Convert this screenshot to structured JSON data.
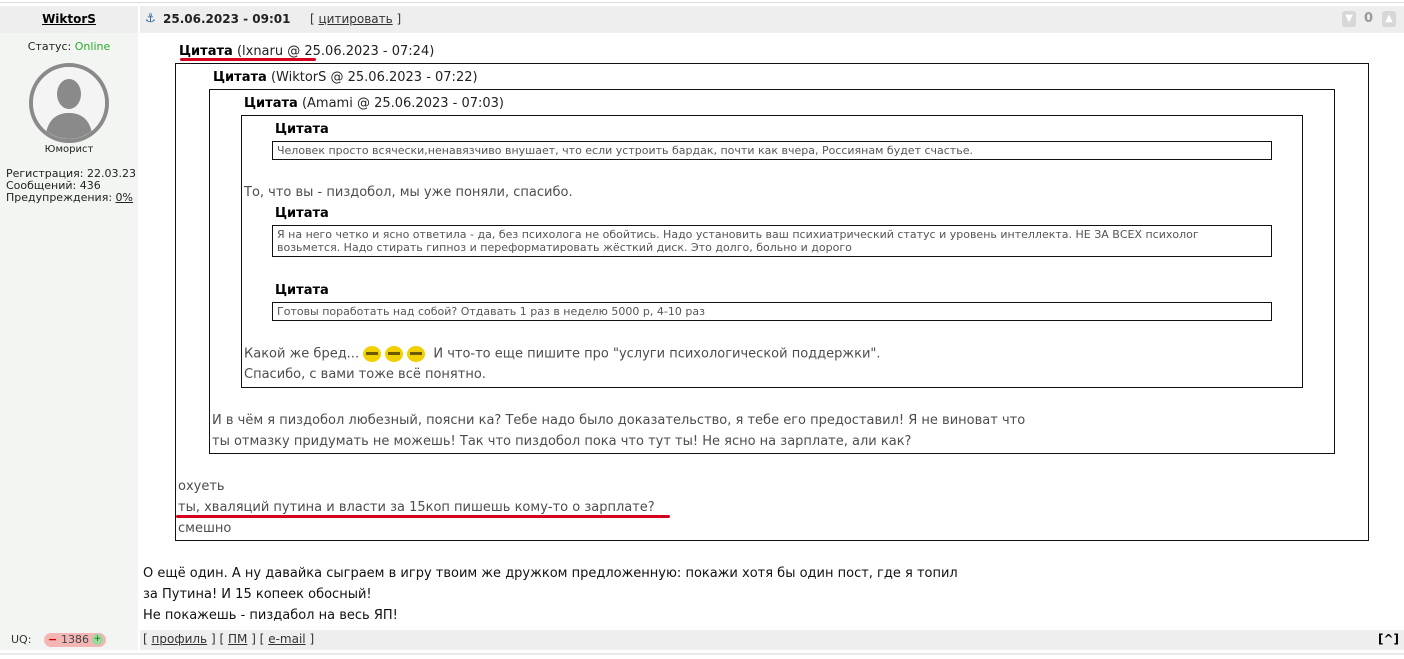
{
  "post": {
    "author": "WiktorS",
    "anchor_icon": "anchor-icon",
    "date": "25.06.2023 - 09:01",
    "quote_open": "[",
    "quote_link": "цитировать",
    "quote_close": "]",
    "rating_count": "0"
  },
  "user": {
    "status_label": "Статус:",
    "status_value": "Online",
    "rank": "Юморист",
    "registration": "Регистрация: 22.03.23",
    "messages": "Сообщений: 436",
    "warnings_label": "Предупреждения:",
    "warnings_value": "0%"
  },
  "quotes": {
    "q1": {
      "label": "Цитата",
      "meta": "(lxnaru @ 25.06.2023 - 07:24)"
    },
    "q2": {
      "label": "Цитата",
      "meta": "(WiktorS @ 25.06.2023 - 07:22)"
    },
    "q3": {
      "label": "Цитата",
      "meta": "(Amami @ 25.06.2023 - 07:03)"
    },
    "q4": {
      "label": "Цитата",
      "text": "Человек просто всячески,ненавязчиво внушает, что если устроить бардак, почти как вчера, Россиянам будет счастье."
    },
    "q3_line1": "То, что вы - пиздобол, мы уже поняли, спасибо.",
    "q5": {
      "label": "Цитата",
      "text_line1": "Я на него четко и ясно ответила - да, без психолога не обойтись. Надо установить ваш психиатрический статус и уровень интеллекта. НЕ ЗА ВСЕХ психолог",
      "text_line2": "возьмется. Надо стирать гипноз и переформатировать жёсткий диск. Это долго, больно и дорого"
    },
    "q6": {
      "label": "Цитата",
      "text": "Готовы поработать над собой? Отдавать 1 раз в неделю 5000 р, 4-10 раз"
    },
    "q3_line2_a": "Какой же бред...",
    "q3_line2_b": "И что-то еще пишите про \"услуги психологической поддержки\".",
    "q3_line3": "Спасибо, с вами тоже всё понятно.",
    "q2_line1": "И в чём я пиздобол любезный, поясни ка? Тебе надо было доказательство, я тебе его предоставил! Я не виноват что",
    "q2_line2": "ты отмазку придумать не можешь! Так что пиздобол пока что тут ты! Не ясно на зарплате, али как?",
    "q1_line1": "охуеть",
    "q1_line2": "ты, хваляций путина и власти за 15коп пишешь кому-то о зарплате?",
    "q1_line3": "смешно"
  },
  "message": {
    "line1": "О ещё один. А ну давайка сыграем в игру твоим же дружком предложенную: покажи хотя бы один пост, где я топил",
    "line2": "за Путина! И 15 копеек обосный!",
    "line3": "Не покажешь - пиздабол на весь ЯП!"
  },
  "footer": {
    "uq_label": "UQ:",
    "uq_minus": "−",
    "uq_value": "1386",
    "uq_plus": "+",
    "link_open": "[",
    "profile": "профиль",
    "sep1": "] [",
    "pm": "ПМ",
    "sep2": "] [",
    "email": "e-mail",
    "link_close": "]",
    "to_top": "[^]"
  },
  "colors": {
    "online": "#2bab2b",
    "underline_mark": "#d6001c",
    "header_bg": "#eeeeee",
    "sidebar_bg": "#f2f5f2"
  }
}
